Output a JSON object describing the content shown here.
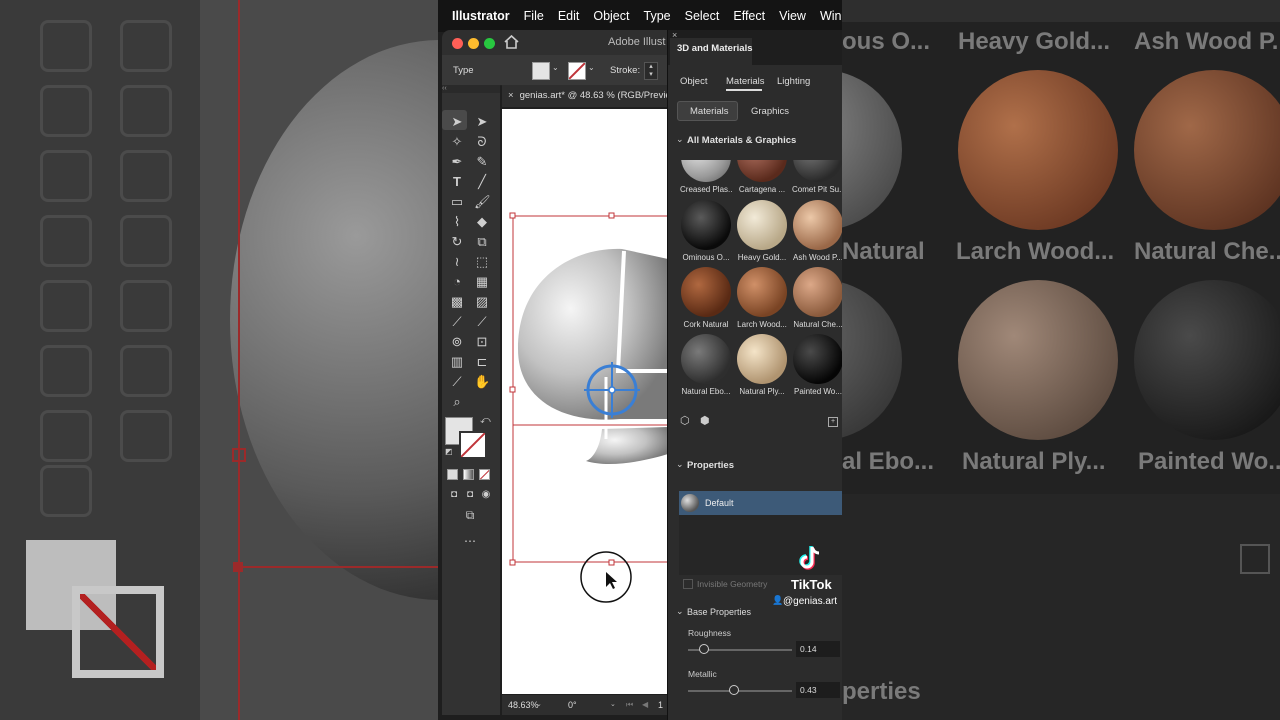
{
  "menubar": {
    "app": "Illustrator",
    "items": [
      "File",
      "Edit",
      "Object",
      "Type",
      "Select",
      "Effect",
      "View",
      "Win"
    ]
  },
  "window": {
    "title": "Adobe Illust",
    "control_bar": {
      "type_label": "Type",
      "stroke_label": "Stroke:"
    },
    "document_tab": "genias.art* @ 48.63 % (RGB/Previe",
    "status": {
      "zoom": "48.63%",
      "angle": "0°",
      "page": "1"
    }
  },
  "panel": {
    "title": "3D and Materials",
    "tabs": [
      "Object",
      "Materials",
      "Lighting"
    ],
    "active_tab": "Materials",
    "subtabs": [
      "Materials",
      "Graphics"
    ],
    "section_all": "All Materials & Graphics",
    "materials": [
      {
        "label": "Creased Plas...",
        "color": "#b5b5b5"
      },
      {
        "label": "Cartagena ...",
        "color": "#7a4a3a"
      },
      {
        "label": "Comet Pit Su...",
        "color": "#4a4a4a"
      },
      {
        "label": "Ominous O...",
        "color": "#1a1a1a"
      },
      {
        "label": "Heavy Gold...",
        "color": "#d8cbb0"
      },
      {
        "label": "Ash Wood P...",
        "color": "#c9997a"
      },
      {
        "label": "Cork Natural",
        "color": "#8a4a2a"
      },
      {
        "label": "Larch Wood...",
        "color": "#a0643c"
      },
      {
        "label": "Natural Che...",
        "color": "#b07a58"
      },
      {
        "label": "Natural Ebo...",
        "color": "#555555"
      },
      {
        "label": "Natural Ply...",
        "color": "#d3bc98"
      },
      {
        "label": "Painted Wo...",
        "color": "#151515"
      }
    ],
    "section_properties": "Properties",
    "default_label": "Default",
    "invisible_geometry": "Invisible Geometry",
    "section_base": "Base Properties",
    "roughness": {
      "label": "Roughness",
      "value": "0.14",
      "level": 0.14
    },
    "metallic": {
      "label": "Metallic",
      "value": "0.43",
      "level": 0.43
    }
  },
  "overlay": {
    "brand": "TikTok",
    "handle": "@genias.art"
  },
  "background_right": {
    "labels": [
      "ous O...",
      "Heavy Gold...",
      "Ash Wood P...",
      "Natural",
      "Larch Wood...",
      "Natural Che...",
      "al Ebo...",
      "Natural Ply...",
      "Painted Wo...",
      "perties"
    ]
  },
  "colors": {
    "accent": "#3a7fd5",
    "selection": "#c0343a",
    "default_row": "#3d5a78"
  }
}
